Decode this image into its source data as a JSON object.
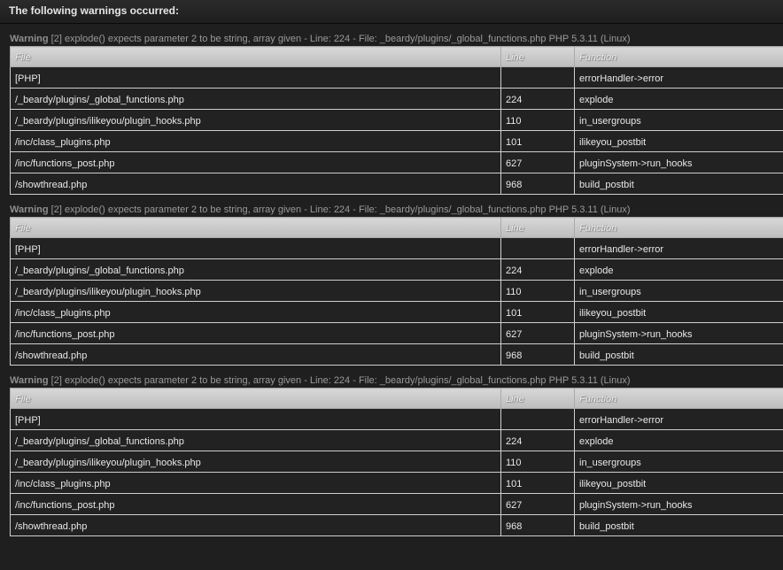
{
  "header": {
    "title": "The following warnings occurred:"
  },
  "columns": {
    "file": "File",
    "line": "Line",
    "function": "Function"
  },
  "warnings": [
    {
      "label": "Warning",
      "message": "[2] explode() expects parameter 2 to be string, array given - Line: 224 - File: _beardy/plugins/_global_functions.php PHP 5.3.11 (Linux)",
      "rows": [
        {
          "file": "[PHP]",
          "line": "",
          "function": "errorHandler->error"
        },
        {
          "file": "/_beardy/plugins/_global_functions.php",
          "line": "224",
          "function": "explode"
        },
        {
          "file": "/_beardy/plugins/ilikeyou/plugin_hooks.php",
          "line": "110",
          "function": "in_usergroups"
        },
        {
          "file": "/inc/class_plugins.php",
          "line": "101",
          "function": "ilikeyou_postbit"
        },
        {
          "file": "/inc/functions_post.php",
          "line": "627",
          "function": "pluginSystem->run_hooks"
        },
        {
          "file": "/showthread.php",
          "line": "968",
          "function": "build_postbit"
        }
      ]
    },
    {
      "label": "Warning",
      "message": "[2] explode() expects parameter 2 to be string, array given - Line: 224 - File: _beardy/plugins/_global_functions.php PHP 5.3.11 (Linux)",
      "rows": [
        {
          "file": "[PHP]",
          "line": "",
          "function": "errorHandler->error"
        },
        {
          "file": "/_beardy/plugins/_global_functions.php",
          "line": "224",
          "function": "explode"
        },
        {
          "file": "/_beardy/plugins/ilikeyou/plugin_hooks.php",
          "line": "110",
          "function": "in_usergroups"
        },
        {
          "file": "/inc/class_plugins.php",
          "line": "101",
          "function": "ilikeyou_postbit"
        },
        {
          "file": "/inc/functions_post.php",
          "line": "627",
          "function": "pluginSystem->run_hooks"
        },
        {
          "file": "/showthread.php",
          "line": "968",
          "function": "build_postbit"
        }
      ]
    },
    {
      "label": "Warning",
      "message": "[2] explode() expects parameter 2 to be string, array given - Line: 224 - File: _beardy/plugins/_global_functions.php PHP 5.3.11 (Linux)",
      "rows": [
        {
          "file": "[PHP]",
          "line": "",
          "function": "errorHandler->error"
        },
        {
          "file": "/_beardy/plugins/_global_functions.php",
          "line": "224",
          "function": "explode"
        },
        {
          "file": "/_beardy/plugins/ilikeyou/plugin_hooks.php",
          "line": "110",
          "function": "in_usergroups"
        },
        {
          "file": "/inc/class_plugins.php",
          "line": "101",
          "function": "ilikeyou_postbit"
        },
        {
          "file": "/inc/functions_post.php",
          "line": "627",
          "function": "pluginSystem->run_hooks"
        },
        {
          "file": "/showthread.php",
          "line": "968",
          "function": "build_postbit"
        }
      ]
    }
  ]
}
